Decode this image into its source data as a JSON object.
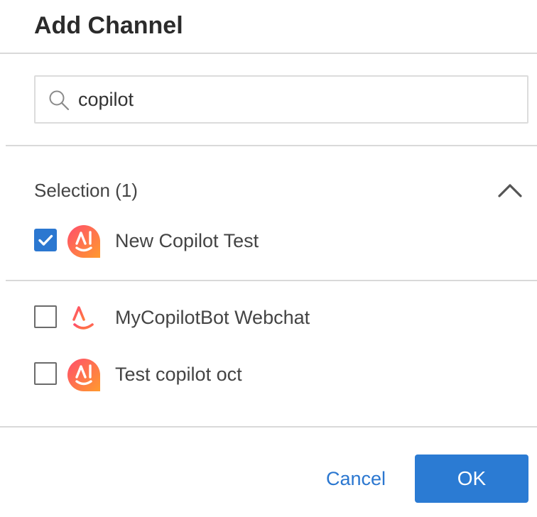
{
  "dialog": {
    "title": "Add Channel"
  },
  "search": {
    "value": "copilot",
    "icon": "search-icon"
  },
  "selection": {
    "header": "Selection (1)",
    "expanded": true,
    "items": [
      {
        "label": "New Copilot Test",
        "checked": true,
        "avatar": "copilot-filled-icon"
      }
    ]
  },
  "results": [
    {
      "label": "MyCopilotBot Webchat",
      "checked": false,
      "avatar": "copilot-outline-icon"
    },
    {
      "label": "Test copilot oct",
      "checked": false,
      "avatar": "copilot-filled-icon"
    }
  ],
  "footer": {
    "cancel_label": "Cancel",
    "ok_label": "OK"
  },
  "colors": {
    "accent": "#2b77d0",
    "avatar_gradient_start": "#ff4d6d",
    "avatar_gradient_end": "#ff9a2e"
  }
}
